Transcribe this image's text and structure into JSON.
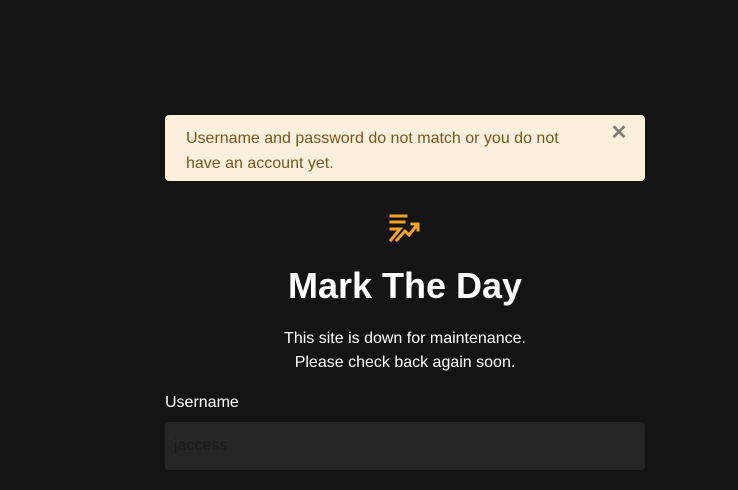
{
  "alert": {
    "message": "Username and password do not match or you do not have an account yet.",
    "close_icon": "close-icon"
  },
  "brand": {
    "logo_icon": "mark-the-day-logo-icon",
    "title": "Mark The Day",
    "accent_color": "#f5a51c"
  },
  "maintenance": {
    "line1": "This site is down for maintenance.",
    "line2": "Please check back again soon."
  },
  "form": {
    "username_label": "Username",
    "username_value": "jaccess"
  }
}
